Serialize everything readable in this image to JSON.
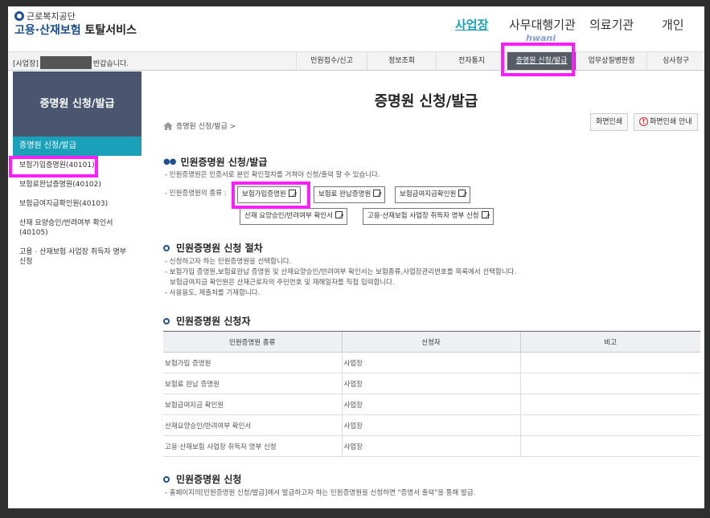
{
  "header": {
    "org_name": "근로복지공단",
    "service_blue": "고용·산재보험",
    "service_dark": "토탈서비스",
    "nav": [
      "사업장",
      "사무대행기관",
      "의료기관",
      "개인"
    ],
    "badge": "hwani"
  },
  "menubar": {
    "greet_prefix": "[사업장]",
    "greet_suffix": "반갑습니다.",
    "items": [
      "민원접수/신고",
      "정보조회",
      "전자통지",
      "증명원 신청/발급",
      "업무상질병판정",
      "심사청구"
    ]
  },
  "sidebar": {
    "title": "증명원 신청/발급",
    "current": "증명원 신청/발급",
    "items": [
      "보험가입증명원(40101)",
      "보험료완납증명원(40102)",
      "보험급여지급확인원(40103)",
      "산재 요양승인/반려여부 확인서 (40105)",
      "고용 · 산재보험 사업장 취득자 명부 신청"
    ]
  },
  "content": {
    "page_title": "증명원 신청/발급",
    "breadcrumb": "증명원 신청/발급 >",
    "print_button": "화면인쇄",
    "print_guide_button": "화면인쇄 안내",
    "section1": {
      "title": "민원증명원 신청/발급",
      "line1": "- 민원증명원은 인증서로 본인 확인절차를 거쳐야 신청/출력 할 수 있습니다.",
      "kind_label": "- 민원증명원의 종류 :",
      "buttons": [
        "보험가입증명원",
        "보험료 완납증명원",
        "보험급여지급확인원",
        "산재 요양승인/반려여부 확인서",
        "고용·산재보험 사업장 취득자 명부 신청"
      ]
    },
    "section2": {
      "title": "민원증명원 신청 절차",
      "lines": [
        "- 신청하고자 하는 민원증명원을 선택합니다.",
        "- 보험가입 증명원,보험료완납 증명원 및 산재요양승인/반려여부 확인서는 보험종류,사업장관리번호를 목록에서 선택합니다.",
        "  보험급여지급 확인원은 산재근로자의 주민번호 및 재해일자를 직접 입력합니다.",
        "- 사용용도, 제출처를 기재합니다."
      ]
    },
    "section3": {
      "title": "민원증명원 신청자",
      "headers": [
        "민원증명원 종류",
        "신청자",
        "비고"
      ],
      "rows": [
        [
          "보험가입 증명원",
          "사업장",
          ""
        ],
        [
          "보험료 완납 증명원",
          "사업장",
          ""
        ],
        [
          "보험급여지급 확인원",
          "사업장",
          ""
        ],
        [
          "산재요양승인/반려여부 확인서",
          "사업장",
          ""
        ],
        [
          "고용·산재보험 사업장 취득자 명부 신청",
          "사업장",
          ""
        ]
      ]
    },
    "section4": {
      "title": "민원증명원 신청",
      "line1": "- 홈페이지의[민원증명원 신청/발급]에서 발급하고자 하는 민원증명원을 신청하면 \"증명서 출력\"을 통해 발급."
    }
  },
  "colors": {
    "accent": "#1aa0b8",
    "brand": "#1d4f91",
    "highlight": "#ff1dff"
  }
}
